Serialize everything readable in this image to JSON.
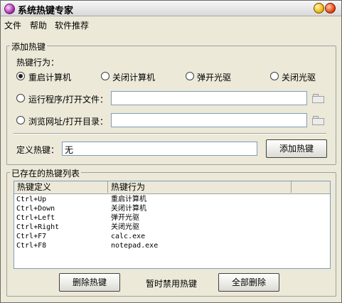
{
  "window": {
    "title": "系统热键专家"
  },
  "menu": [
    "文件",
    "帮助",
    "软件推荐"
  ],
  "add_group": {
    "label": "添加热键",
    "action_label": "热键行为：",
    "radios": [
      {
        "label": "重启计算机",
        "selected": true
      },
      {
        "label": "关闭计算机",
        "selected": false
      },
      {
        "label": "弹开光驱",
        "selected": false
      },
      {
        "label": "关闭光驱",
        "selected": false
      }
    ],
    "run_program_label": "运行程序/打开文件：",
    "run_program_value": "",
    "browse_url_label": "浏览网址/打开目录：",
    "browse_url_value": "",
    "define_label": "定义热键：",
    "define_value": "无",
    "add_button": "添加热键"
  },
  "list_group": {
    "label": "已存在的热键列表",
    "columns": [
      "热键定义",
      "热键行为"
    ],
    "rows": [
      {
        "key": "Ctrl+Up",
        "action": "重启计算机"
      },
      {
        "key": "Ctrl+Down",
        "action": "关闭计算机"
      },
      {
        "key": "Ctrl+Left",
        "action": "弹开光驱"
      },
      {
        "key": "Ctrl+Right",
        "action": "关闭光驱"
      },
      {
        "key": "Ctrl+F7",
        "action": "calc.exe"
      },
      {
        "key": "Ctrl+F8",
        "action": "notepad.exe"
      }
    ],
    "delete_button": "删除热键",
    "disable_button": "暂时禁用热键",
    "delete_all_button": "全部删除"
  }
}
